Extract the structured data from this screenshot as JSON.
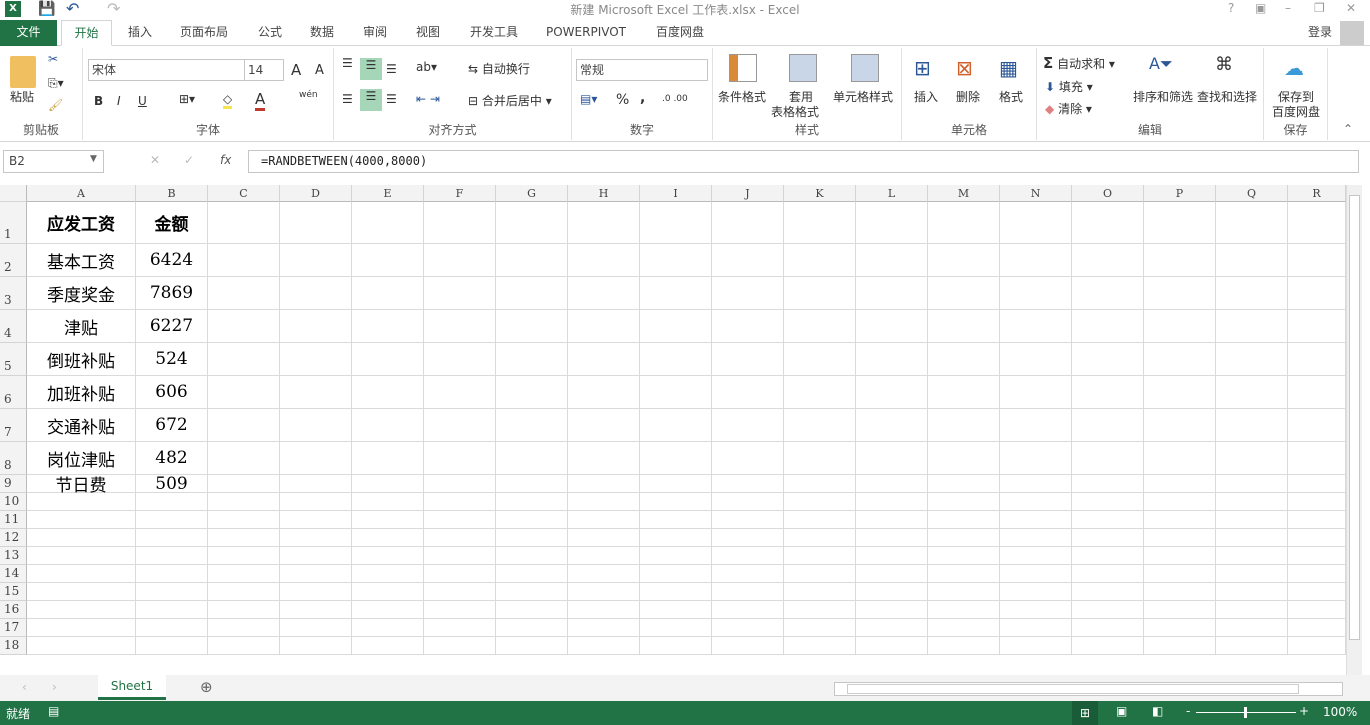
{
  "window": {
    "title": "新建 Microsoft Excel 工作表.xlsx - Excel",
    "help": "?",
    "minimize": "–",
    "restore": "❐",
    "close": "✕"
  },
  "tabs": [
    "文件",
    "开始",
    "插入",
    "页面布局",
    "公式",
    "数据",
    "审阅",
    "视图",
    "开发工具",
    "POWERPIVOT",
    "百度网盘"
  ],
  "login": "登录",
  "ribbon": {
    "clipboard": {
      "label": "剪贴板",
      "paste": "粘贴"
    },
    "font": {
      "label": "字体",
      "name": "宋体",
      "size": "14",
      "bold": "B",
      "italic": "I",
      "underline": "U",
      "grow": "A",
      "shrink": "A",
      "phonetic": "wén"
    },
    "alignment": {
      "label": "对齐方式",
      "wrap": "自动换行",
      "merge": "合并后居中"
    },
    "number": {
      "label": "数字",
      "format": "常规",
      "percent": "%",
      "comma": ","
    },
    "styles": {
      "label": "样式",
      "conditional": "条件格式",
      "table1": "套用",
      "table2": "表格格式",
      "cell": "单元格样式"
    },
    "cells": {
      "label": "单元格",
      "insert": "插入",
      "delete": "删除",
      "format": "格式"
    },
    "editing": {
      "label": "编辑",
      "autosum": "自动求和",
      "fill": "填充",
      "clear": "清除",
      "sort": "排序和筛选",
      "find": "查找和选择"
    },
    "save": {
      "label": "保存",
      "line1": "保存到",
      "line2": "百度网盘"
    }
  },
  "formula_bar": {
    "name_box": "B2",
    "fx": "fx",
    "formula": "=RANDBETWEEN(4000,8000)"
  },
  "columns": [
    "A",
    "B",
    "C",
    "D",
    "E",
    "F",
    "G",
    "H",
    "I",
    "J",
    "K",
    "L",
    "M",
    "N",
    "O",
    "P",
    "Q",
    "R"
  ],
  "rows": [
    "1",
    "2",
    "3",
    "4",
    "5",
    "6",
    "7",
    "8",
    "9",
    "10",
    "11",
    "12",
    "13",
    "14",
    "15",
    "16",
    "17",
    "18"
  ],
  "cells": [
    [
      "应发工资",
      "金额"
    ],
    [
      "基本工资",
      "6424"
    ],
    [
      "季度奖金",
      "7869"
    ],
    [
      "津贴",
      "6227"
    ],
    [
      "倒班补贴",
      "524"
    ],
    [
      "加班补贴",
      "606"
    ],
    [
      "交通补贴",
      "672"
    ],
    [
      "岗位津贴",
      "482"
    ],
    [
      "节日费",
      "509"
    ]
  ],
  "sheets": [
    "Sheet1"
  ],
  "status": {
    "ready": "就绪",
    "zoom": "100%"
  },
  "colors": {
    "accent": "#217346",
    "selected_align": "#a5d6b8"
  }
}
